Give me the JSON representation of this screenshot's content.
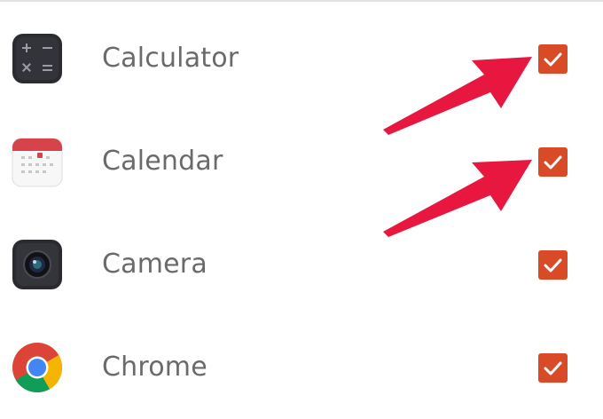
{
  "apps": [
    {
      "label": "Calculator",
      "icon": "calculator-icon",
      "checked": true
    },
    {
      "label": "Calendar",
      "icon": "calendar-icon",
      "checked": true
    },
    {
      "label": "Camera",
      "icon": "camera-icon",
      "checked": true
    },
    {
      "label": "Chrome",
      "icon": "chrome-icon",
      "checked": true
    }
  ],
  "colors": {
    "checkbox": "#d84b26",
    "annotation_arrow": "#e8173f",
    "label_text": "#6a6a6a"
  }
}
